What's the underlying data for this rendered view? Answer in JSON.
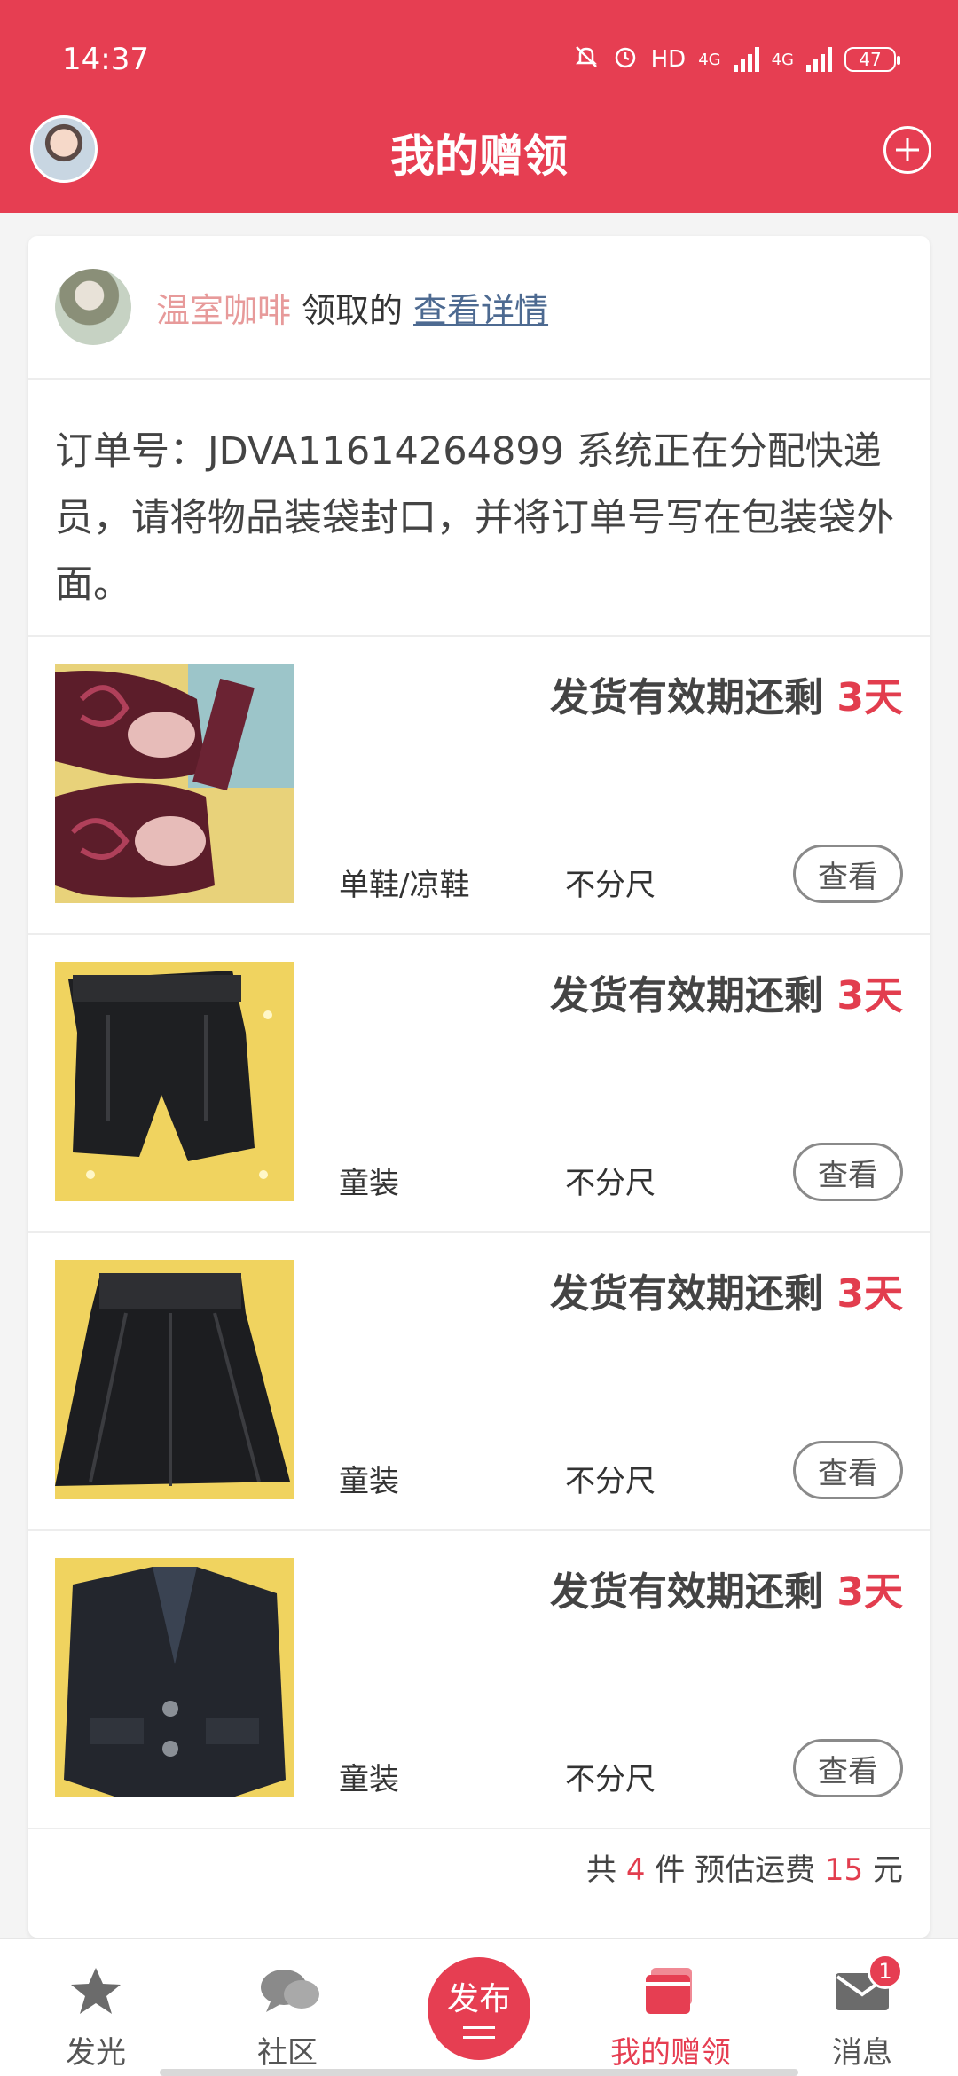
{
  "status_bar": {
    "time": "14:37",
    "network_label": "HD",
    "signal_1": "4G",
    "signal_2": "4G",
    "battery": "47"
  },
  "header": {
    "title": "我的赠领"
  },
  "claim": {
    "user": "温室咖啡",
    "action": "领取的",
    "link": "查看详情"
  },
  "order_notice": "订单号：JDVA11614264899 系统正在分配快递员，请将物品装袋封口，并将订单号写在包装袋外面。",
  "items": [
    {
      "deadline_label": "发货有效期还剩",
      "deadline_value": "3天",
      "category": "单鞋/凉鞋",
      "size": "不分尺",
      "view": "查看"
    },
    {
      "deadline_label": "发货有效期还剩",
      "deadline_value": "3天",
      "category": "童装",
      "size": "不分尺",
      "view": "查看"
    },
    {
      "deadline_label": "发货有效期还剩",
      "deadline_value": "3天",
      "category": "童装",
      "size": "不分尺",
      "view": "查看"
    },
    {
      "deadline_label": "发货有效期还剩",
      "deadline_value": "3天",
      "category": "童装",
      "size": "不分尺",
      "view": "查看"
    }
  ],
  "summary": {
    "prefix": "共",
    "count": "4",
    "mid": "件 预估运费",
    "fee": "15",
    "unit": "元"
  },
  "tabbar": {
    "tabs": [
      {
        "label": "发光",
        "icon": "star-icon"
      },
      {
        "label": "社区",
        "icon": "chat-bubbles-icon"
      },
      {
        "label": "发布",
        "icon": "publish-icon"
      },
      {
        "label": "我的赠领",
        "icon": "gift-cards-icon"
      },
      {
        "label": "消息",
        "icon": "mail-icon"
      }
    ],
    "message_badge": "1"
  },
  "colors": {
    "brand": "#e63e52",
    "link": "#4d6a91",
    "username": "#e79a9a"
  }
}
